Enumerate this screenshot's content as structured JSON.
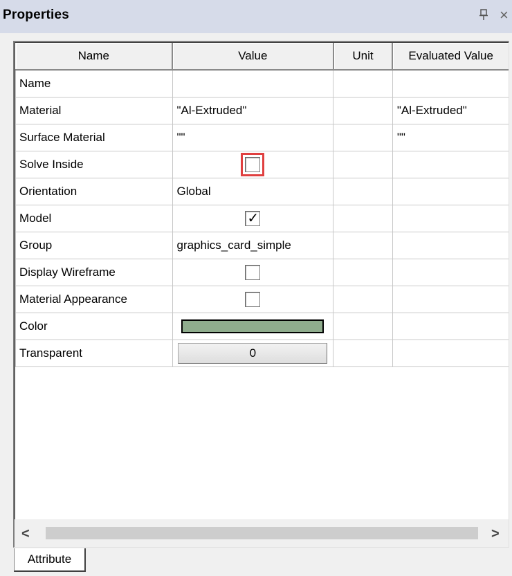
{
  "window": {
    "title": "Properties",
    "pin_glyph": "ᚁ",
    "close_glyph": "×"
  },
  "table": {
    "headers": [
      "Name",
      "Value",
      "Unit",
      "Evaluated Value"
    ],
    "rows": [
      {
        "name": "Name",
        "value": "",
        "unit": "",
        "evaluated": ""
      },
      {
        "name": "Material",
        "value": "\"Al-Extruded\"",
        "unit": "",
        "evaluated": "\"Al-Extruded\""
      },
      {
        "name": "Surface Material",
        "value": "\"\"",
        "unit": "",
        "evaluated": "\"\""
      },
      {
        "name": "Solve Inside",
        "checkbox": false,
        "highlighted": true,
        "unit": "",
        "evaluated": ""
      },
      {
        "name": "Orientation",
        "value": "Global",
        "unit": "",
        "evaluated": ""
      },
      {
        "name": "Model",
        "checkbox": true,
        "unit": "",
        "evaluated": ""
      },
      {
        "name": "Group",
        "value": "graphics_card_simple",
        "unit": "",
        "evaluated": ""
      },
      {
        "name": "Display Wireframe",
        "checkbox": false,
        "unit": "",
        "evaluated": ""
      },
      {
        "name": "Material Appearance",
        "checkbox": false,
        "unit": "",
        "evaluated": ""
      },
      {
        "name": "Color",
        "color": "#8fac8d",
        "unit": "",
        "evaluated": ""
      },
      {
        "name": "Transparent",
        "value": "0",
        "unit": "",
        "evaluated": ""
      }
    ]
  },
  "scrollbar": {
    "left_arrow": "<",
    "right_arrow": ">"
  },
  "tabs": {
    "attribute": "Attribute"
  },
  "colors": {
    "highlight": "#e04040",
    "titlebar": "#d6dbe9",
    "panel": "#f0f0f0"
  }
}
